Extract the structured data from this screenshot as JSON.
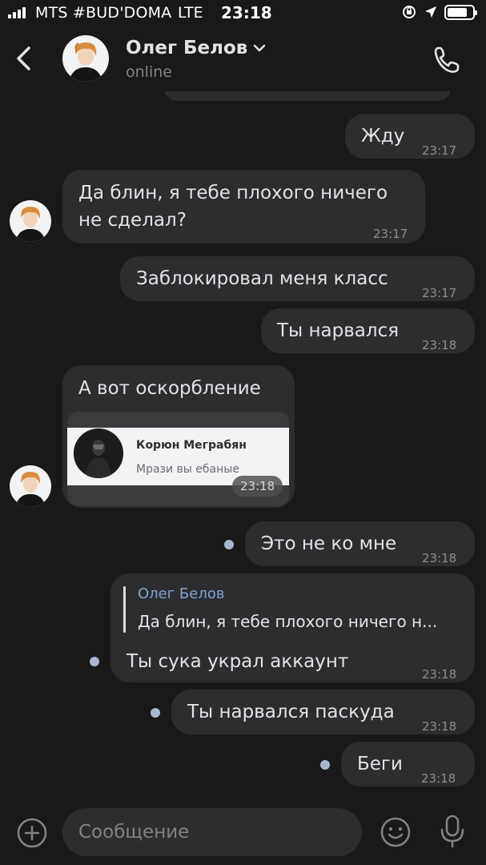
{
  "status_bar": {
    "carrier": "MTS #BUD'DOMA",
    "network": "LTE",
    "time": "23:18",
    "battery_level": 0.8
  },
  "header": {
    "name": "Олег Белов",
    "status": "online"
  },
  "messages": [
    {
      "text": "Жду",
      "time": "23:17"
    },
    {
      "text": "Да блин, я тебе плохого ничего",
      "text2": "не сделал?",
      "time": "23:17"
    },
    {
      "text": "Заблокировал меня класс",
      "time": "23:17"
    },
    {
      "text": "Ты нарвался",
      "time": "23:18"
    },
    {
      "text": "А вот оскорбление",
      "forward_name": "Корюн Меграбян",
      "forward_text": "Мрази вы ебаные",
      "time": "23:18"
    },
    {
      "text": "Это не ко мне",
      "time": "23:18"
    },
    {
      "reply_name": "Олег Белов",
      "reply_text": "Да блин, я тебе плохого ничего н...",
      "text": "Ты сука украл аккаунт",
      "time": "23:18"
    },
    {
      "text": "Ты нарвался паскуда",
      "time": "23:18"
    },
    {
      "text": "Беги",
      "time": "23:18"
    }
  ],
  "composer": {
    "placeholder": "Сообщение"
  },
  "colors": {
    "background": "#19191a",
    "bubble": "#2c2d2e",
    "accent": "#7fa3d7",
    "unread_dot": "#a8b8d3"
  }
}
